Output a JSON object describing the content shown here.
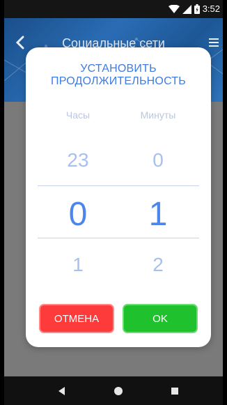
{
  "status_bar": {
    "time": "3:52",
    "icons": [
      "wifi-icon",
      "signal-icon",
      "battery-icon"
    ]
  },
  "header": {
    "title": "Социальные сети",
    "back_icon": "chevron-left-icon",
    "menu_icon": "menu-icon"
  },
  "dialog": {
    "title_line1": "УСТАНОВИТЬ",
    "title_line2": "ПРОДОЛЖИТЕЛЬНОСТЬ",
    "hours": {
      "label": "Часы",
      "prev": "23",
      "selected": "0",
      "next": "1"
    },
    "minutes": {
      "label": "Минуты",
      "prev": "0",
      "selected": "1",
      "next": "2"
    },
    "cancel_label": "ОТМЕНА",
    "ok_label": "OK"
  },
  "colors": {
    "accent": "#4d86ea",
    "cancel": "#fe3b3b",
    "ok": "#1fc12d",
    "header": "#2a6cb4"
  },
  "nav_bar": {
    "icons": [
      "back-triangle-icon",
      "home-circle-icon",
      "recents-square-icon"
    ]
  }
}
